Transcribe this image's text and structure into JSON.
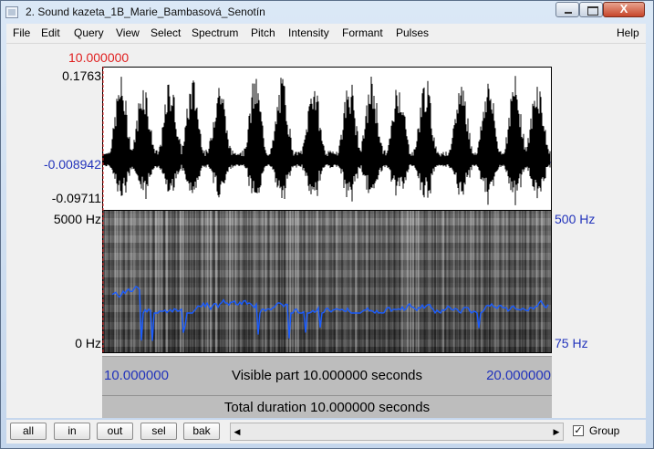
{
  "window": {
    "title": "2. Sound kazeta_1B_Marie_Bambasová_Senotín",
    "close_glyph": "X"
  },
  "menu": [
    "File",
    "Edit",
    "Query",
    "View",
    "Select",
    "Spectrum",
    "Pitch",
    "Intensity",
    "Formant",
    "Pulses",
    "Help"
  ],
  "cursor_time": "10.000000",
  "sound": {
    "max_label": "0.1763",
    "mid_label": "-0.008942",
    "min_label": "-0.09711"
  },
  "spectrogram": {
    "max_freq_label": "5000 Hz",
    "min_freq_label": "0 Hz"
  },
  "pitch": {
    "max_label": "500 Hz",
    "min_label": "75 Hz",
    "color": "#1a5cff"
  },
  "visible": {
    "start": "10.000000",
    "text": "Visible part 10.000000 seconds",
    "end": "20.000000"
  },
  "total": {
    "text": "Total duration 10.000000 seconds"
  },
  "buttons": {
    "all": "all",
    "in": "in",
    "out": "out",
    "sel": "sel",
    "bak": "bak"
  },
  "scroll": {
    "left_glyph": "◀",
    "right_glyph": "▶"
  },
  "group": {
    "label": "Group",
    "checked": true,
    "check_glyph": "✓"
  },
  "colors": {
    "cursor": "#e02020",
    "blue_label": "#2233bb"
  }
}
